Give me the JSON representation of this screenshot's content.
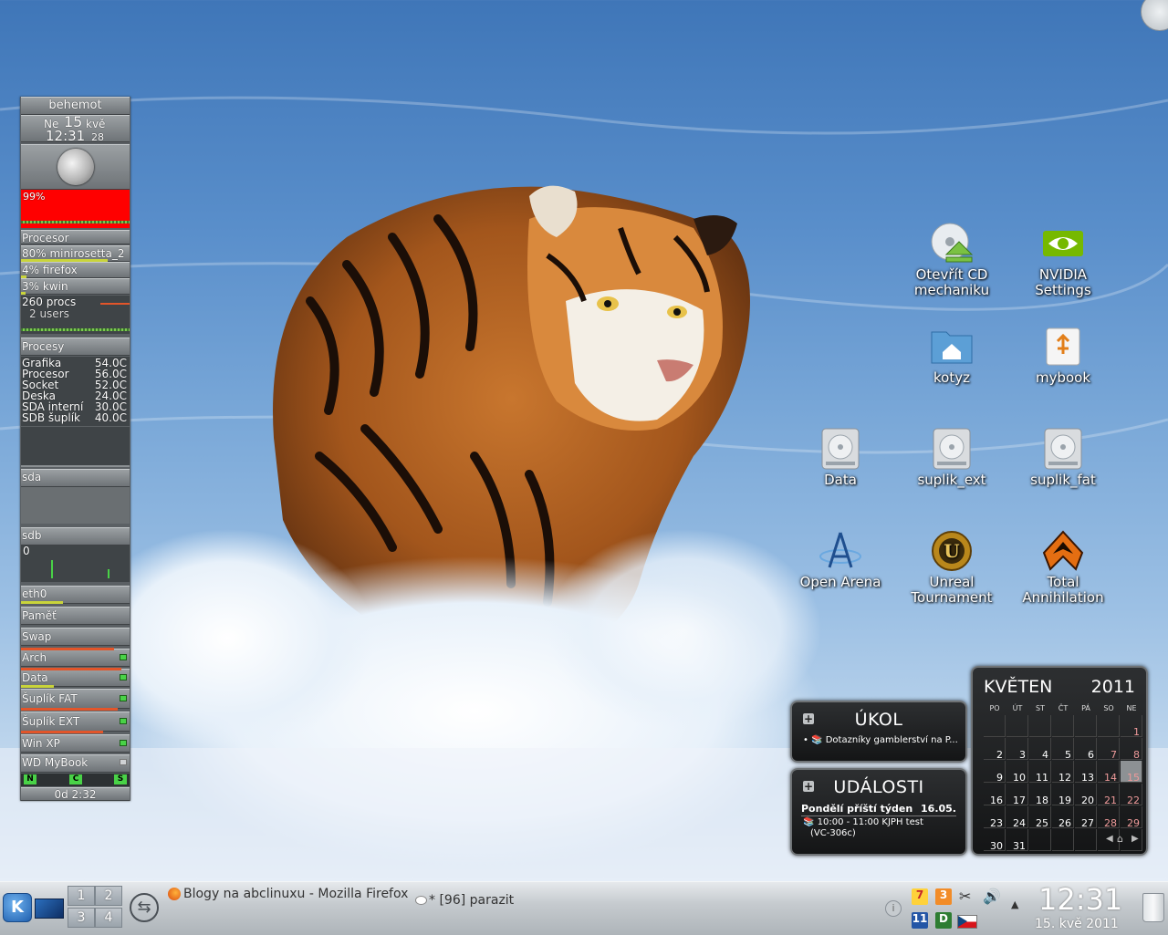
{
  "conky": {
    "hostname": "behemot",
    "date_day": "Ne",
    "date_num": "15",
    "date_month": "kvě",
    "time": "12:31",
    "time_seconds": "28",
    "cpu_percent": "99%",
    "cpu_section": "Procesor",
    "top_processes": [
      "80% minirosetta_2",
      "4% firefox",
      "3% kwin"
    ],
    "procs": "260 procs",
    "users": "2 users",
    "procs_section": "Procesy",
    "temperatures": [
      {
        "label": "Grafika",
        "value": "54.0C"
      },
      {
        "label": "Procesor",
        "value": "56.0C"
      },
      {
        "label": "Socket",
        "value": "52.0C"
      },
      {
        "label": "Deska",
        "value": "24.0C"
      },
      {
        "label": "SDA interní",
        "value": "30.0C"
      },
      {
        "label": "SDB šuplík",
        "value": "40.0C"
      }
    ],
    "sda": "sda",
    "sdb": "sdb",
    "sdb_value": "0",
    "eth": "eth0",
    "mem": "Paměť",
    "swap": "Swap",
    "disks": [
      "Arch",
      "Data",
      "Šuplík FAT",
      "Šuplík EXT",
      "Win XP",
      "WD MyBook"
    ],
    "indicators": [
      "N",
      "C",
      "S"
    ],
    "uptime": "0d  2:32"
  },
  "desktop_icons": [
    {
      "label": "Otevřít CD mechaniku",
      "icon": "cd-eject-icon"
    },
    {
      "label": "NVIDIA Settings",
      "icon": "nvidia-icon"
    },
    {
      "label": "kotyz",
      "icon": "home-folder-icon"
    },
    {
      "label": "mybook",
      "icon": "usb-drive-icon"
    },
    {
      "label": "Data",
      "icon": "hard-disk-icon"
    },
    {
      "label": "suplik_ext",
      "icon": "hard-disk-icon"
    },
    {
      "label": "suplik_fat",
      "icon": "hard-disk-icon"
    },
    {
      "label": "Open Arena",
      "icon": "open-arena-icon"
    },
    {
      "label": "Unreal Tournament",
      "icon": "unreal-icon"
    },
    {
      "label": "Total Annihilation",
      "icon": "total-annihilation-icon"
    }
  ],
  "todo_widget": {
    "title": "ÚKOL",
    "item": "Dotazníky gamblerství na P..."
  },
  "events_widget": {
    "title": "UDÁLOSTI",
    "heading": "Pondělí příští týden",
    "date": "16.05.",
    "event_time": "10:00 - 11:00 KJPH test",
    "event_place": "(VC-306c)"
  },
  "calendar": {
    "month": "KVĚTEN",
    "year": "2011",
    "weekdays": [
      "PO",
      "ÚT",
      "ST",
      "ČT",
      "PÁ",
      "SO",
      "NE"
    ],
    "weeks": [
      [
        "",
        "",
        "",
        "",
        "",
        "",
        "1"
      ],
      [
        "2",
        "3",
        "4",
        "5",
        "6",
        "7",
        "8"
      ],
      [
        "9",
        "10",
        "11",
        "12",
        "13",
        "14",
        "15"
      ],
      [
        "16",
        "17",
        "18",
        "19",
        "20",
        "21",
        "22"
      ],
      [
        "23",
        "24",
        "25",
        "26",
        "27",
        "28",
        "29"
      ],
      [
        "30",
        "31",
        "",
        "",
        "",
        "",
        ""
      ]
    ],
    "today": "15"
  },
  "taskbar": {
    "pager": [
      "1",
      "2",
      "3",
      "4"
    ],
    "tasks": [
      "Blogy na abclinuxu - Mozilla Firefox",
      "* [96] parazit"
    ],
    "tray_badges": [
      "7",
      "3",
      "11",
      "D"
    ],
    "clock_time": "12:31",
    "clock_date": "15. kvě 2011"
  },
  "colors": {
    "cpu_graph": "#ff0000",
    "accent_orange": "#e2552a",
    "led_green": "#49d247"
  }
}
